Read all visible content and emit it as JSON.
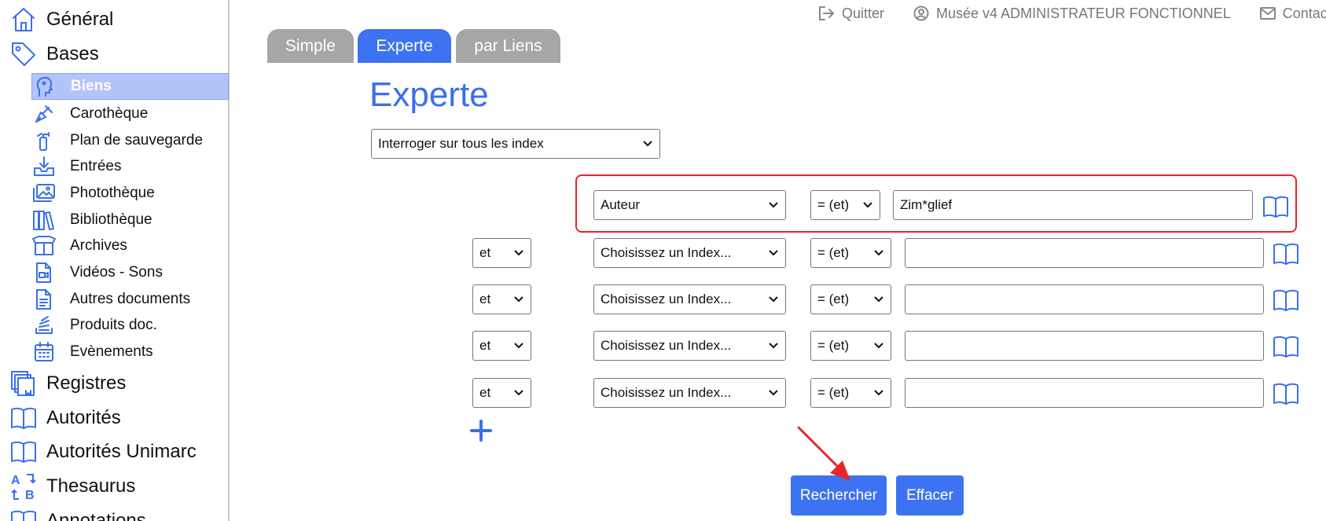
{
  "sidebar": {
    "main_items": [
      {
        "label": "Général",
        "icon": "home-icon"
      },
      {
        "label": "Bases",
        "icon": "tag-icon"
      },
      {
        "label": "Registres",
        "icon": "registers-icon"
      },
      {
        "label": "Autorités",
        "icon": "book-open-icon"
      },
      {
        "label": "Autorités Unimarc",
        "icon": "book-open-icon"
      },
      {
        "label": "Thesaurus",
        "icon": "thesaurus-icon"
      },
      {
        "label": "Annotations",
        "icon": "book-open-icon"
      }
    ],
    "sub_items": [
      {
        "label": "Biens",
        "icon": "bust-icon",
        "active": true
      },
      {
        "label": "Carothèque",
        "icon": "pen-icon"
      },
      {
        "label": "Plan de sauvegarde",
        "icon": "extinguisher-icon"
      },
      {
        "label": "Entrées",
        "icon": "inbox-download-icon"
      },
      {
        "label": "Photothèque",
        "icon": "images-icon"
      },
      {
        "label": "Bibliothèque",
        "icon": "books-icon"
      },
      {
        "label": "Archives",
        "icon": "box-icon"
      },
      {
        "label": "Vidéos - Sons",
        "icon": "video-file-icon"
      },
      {
        "label": "Autres documents",
        "icon": "document-icon"
      },
      {
        "label": "Produits doc.",
        "icon": "stack-icon"
      },
      {
        "label": "Evènements",
        "icon": "calendar-icon"
      }
    ]
  },
  "topbar": {
    "quit_label": "Quitter",
    "user_label": "Musée v4 ADMINISTRATEUR FONCTIONNEL",
    "contact_label": "Contact"
  },
  "tabs": [
    {
      "label": "Simple",
      "active": false
    },
    {
      "label": "Experte",
      "active": true
    },
    {
      "label": "par Liens",
      "active": false
    }
  ],
  "page_title": "Experte",
  "index_scope": {
    "selected": "Interroger sur tous les index"
  },
  "criteria": [
    {
      "connector": "",
      "index": "Auteur",
      "operator": "= (et)",
      "value": "Zim*glief",
      "highlighted": true
    },
    {
      "connector": "et",
      "index": "Choisissez un Index...",
      "operator": "= (et)",
      "value": ""
    },
    {
      "connector": "et",
      "index": "Choisissez un Index...",
      "operator": "= (et)",
      "value": ""
    },
    {
      "connector": "et",
      "index": "Choisissez un Index...",
      "operator": "= (et)",
      "value": ""
    },
    {
      "connector": "et",
      "index": "Choisissez un Index...",
      "operator": "= (et)",
      "value": ""
    }
  ],
  "actions": {
    "search_label": "Rechercher",
    "clear_label": "Effacer"
  },
  "colors": {
    "accent": "#3d73f2",
    "tab_inactive": "#a6a6a6",
    "highlight": "#e5262c",
    "sidebar_active": "#b3c4fb"
  }
}
